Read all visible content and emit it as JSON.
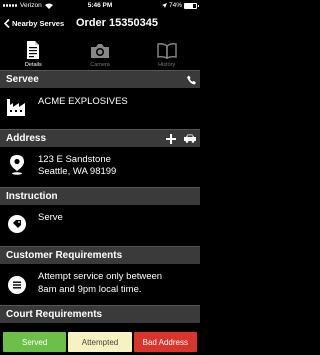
{
  "status_bar": {
    "carrier": "Verizon",
    "time": "5:46 PM",
    "battery": "74%",
    "battery_level": 0.74
  },
  "nav": {
    "back_label": "Nearby Serves",
    "title": "Order 15350345"
  },
  "tabs": [
    {
      "label": "Details",
      "icon": "document-icon",
      "active": true
    },
    {
      "label": "Camera",
      "icon": "camera-icon",
      "active": false
    },
    {
      "label": "History",
      "icon": "book-icon",
      "active": false
    }
  ],
  "servee": {
    "header": "Servee",
    "name": "ACME EXPLOSIVES"
  },
  "address": {
    "header": "Address",
    "line1": "123 E Sandstone",
    "line2": "Seattle, WA 98199"
  },
  "instruction": {
    "header": "Instruction",
    "text": "Serve"
  },
  "customer_requirements": {
    "header": "Customer Requirements",
    "line1": "Attempt service only between",
    "line2": "8am and 9pm local time."
  },
  "court_requirements": {
    "header": "Court Requirements"
  },
  "actions": {
    "served": "Served",
    "attempted": "Attempted",
    "bad_address": "Bad Address"
  },
  "colors": {
    "section_bg": "#3a3a3a",
    "served": "#6cc04a",
    "attempted": "#f7f2c2",
    "bad_address": "#d9352b"
  }
}
